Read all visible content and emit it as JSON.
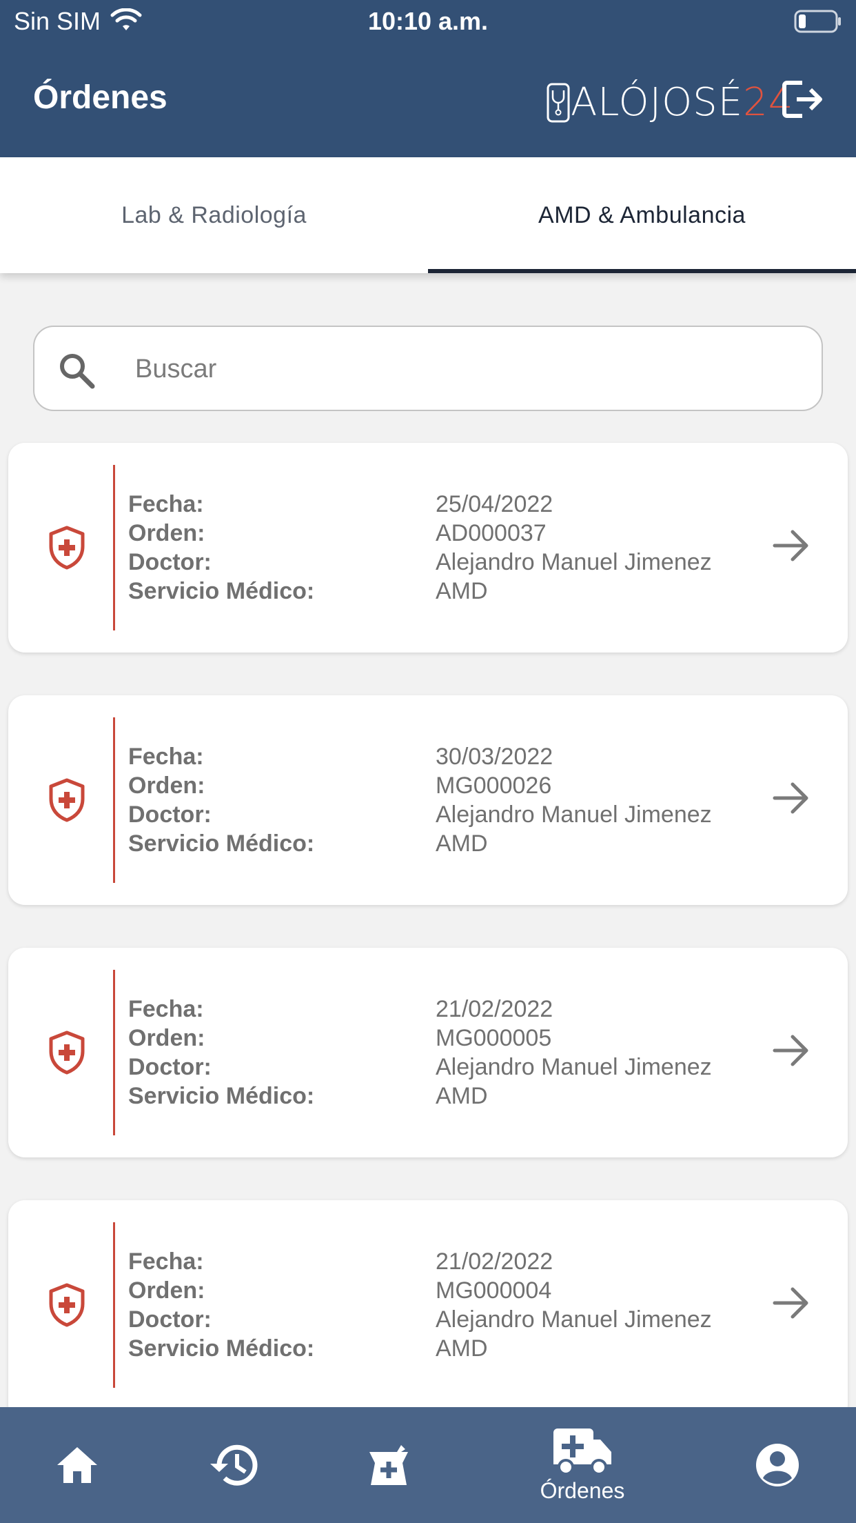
{
  "status_bar": {
    "carrier": "Sin SIM",
    "time": "10:10 a.m."
  },
  "header": {
    "title": "Órdenes",
    "logo_text": "ALÓJOSÉ",
    "logo_number": "24"
  },
  "tabs": [
    {
      "label": "Lab & Radiología",
      "active": false
    },
    {
      "label": "AMD & Ambulancia",
      "active": true
    }
  ],
  "search": {
    "placeholder": "Buscar",
    "value": ""
  },
  "labels": {
    "fecha": "Fecha:",
    "orden": "Orden:",
    "doctor": "Doctor:",
    "servicio": "Servicio Médico:"
  },
  "orders": [
    {
      "fecha": "25/04/2022",
      "orden": "AD000037",
      "doctor": "Alejandro Manuel Jimenez",
      "servicio": "AMD"
    },
    {
      "fecha": "30/03/2022",
      "orden": "MG000026",
      "doctor": "Alejandro Manuel Jimenez",
      "servicio": "AMD"
    },
    {
      "fecha": "21/02/2022",
      "orden": "MG000005",
      "doctor": "Alejandro Manuel Jimenez",
      "servicio": "AMD"
    },
    {
      "fecha": "21/02/2022",
      "orden": "MG000004",
      "doctor": "Alejandro Manuel Jimenez",
      "servicio": "AMD"
    }
  ],
  "bottom_nav": [
    {
      "icon": "home-icon",
      "label": ""
    },
    {
      "icon": "history-icon",
      "label": ""
    },
    {
      "icon": "pharmacy-icon",
      "label": ""
    },
    {
      "icon": "ambulance-icon",
      "label": "Órdenes",
      "active": true
    },
    {
      "icon": "account-icon",
      "label": ""
    }
  ],
  "colors": {
    "header_bg": "#335075",
    "nav_bg": "#4a6488",
    "accent_red": "#c9483a"
  }
}
